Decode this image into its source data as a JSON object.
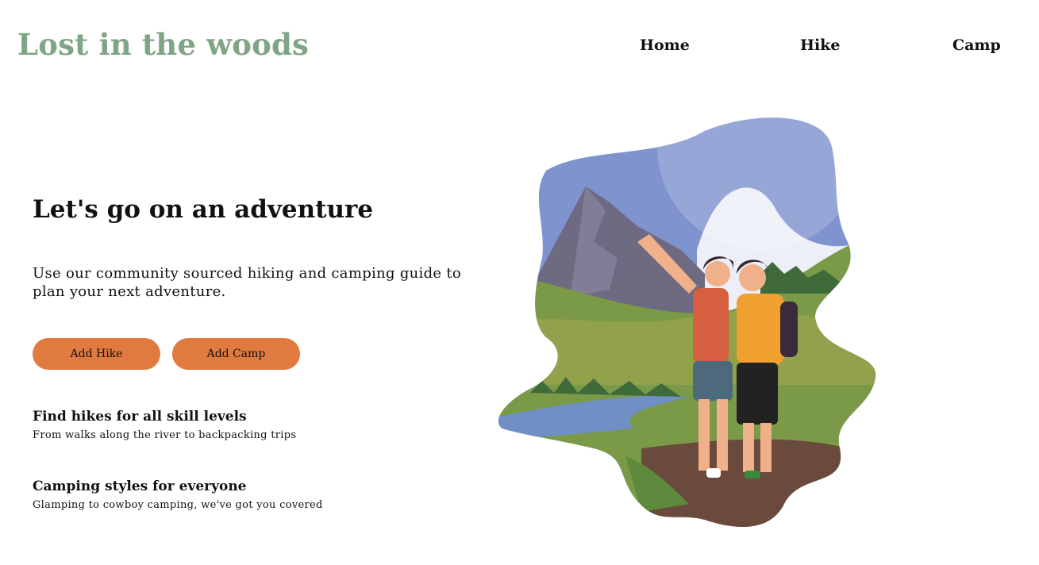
{
  "header": {
    "logo": "Lost in the woods",
    "nav": [
      {
        "label": "Home"
      },
      {
        "label": "Hike"
      },
      {
        "label": "Camp"
      }
    ]
  },
  "hero": {
    "title": "Let's go on an adventure",
    "text": "Use our community sourced hiking and camping guide to plan your next adventure.",
    "buttons": {
      "add_hike": "Add Hike",
      "add_camp": "Add Camp"
    }
  },
  "features": [
    {
      "title": "Find hikes for all skill levels",
      "text": "From walks along the river to backpacking trips"
    },
    {
      "title": "Camping styles for everyone",
      "text": "Glamping to cowboy camping, we've got you covered"
    }
  ],
  "illustration": {
    "subject": "two-hikers-landscape",
    "colors": {
      "accent": "#e07a3f",
      "logo": "#7fa585",
      "sky": "#7f93cf",
      "mountain": "#6e6a82",
      "grass": "#7a9a48",
      "river": "#6f8fc6",
      "path": "#6a4a3c"
    }
  }
}
